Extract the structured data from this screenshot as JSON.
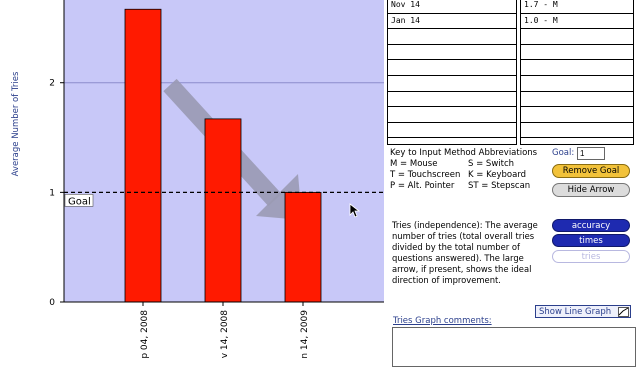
{
  "chart_data": {
    "type": "bar",
    "categories": [
      "p 04, 2008",
      "v 14, 2008",
      "n 14, 2009"
    ],
    "values": [
      2.67,
      1.67,
      1.0
    ],
    "ylabel": "Average Number of Tries",
    "yticks": [
      "0",
      "1",
      "2"
    ],
    "ylim": [
      0,
      2.8
    ],
    "goal": {
      "value": 1,
      "label": "Goal"
    },
    "colors": {
      "bar": "#ff1a00",
      "plot_bg": "#c8c8f8",
      "arrow": "#9a9ab4",
      "grid": "#8c8ccc"
    }
  },
  "sessions_table": {
    "left": [
      "Nov 14",
      "Jan 14",
      "",
      "",
      "",
      "",
      "",
      "",
      "",
      ""
    ],
    "right": [
      "1.7 - M",
      "1.0 - M",
      "",
      "",
      "",
      "",
      "",
      "",
      "",
      ""
    ]
  },
  "key": {
    "title": "Key to Input Method Abbreviations",
    "items": [
      [
        "M =  Mouse",
        "S =  Switch"
      ],
      [
        "T =  Touchscreen",
        "K =  Keyboard"
      ],
      [
        "P =  Alt. Pointer",
        "ST = Stepscan"
      ]
    ]
  },
  "goal": {
    "label": "Goal:",
    "value": "1"
  },
  "buttons": {
    "remove_goal": "Remove Goal",
    "hide_arrow": "Hide Arrow",
    "accuracy": "accuracy",
    "times": "times",
    "tries": "tries",
    "show_line_graph": "Show Line Graph"
  },
  "description": "Tries (independence): The average number of tries (total overall tries divided by the total number of questions answered). The large arrow, if present, shows the ideal direction of improvement.",
  "comments_label": "Tries Graph comments:"
}
